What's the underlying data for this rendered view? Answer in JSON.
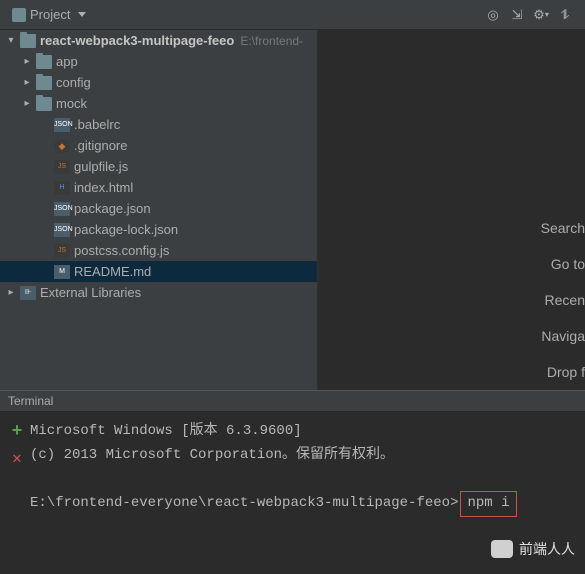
{
  "toolbar": {
    "project_label": "Project"
  },
  "tree": {
    "root": {
      "name": "react-webpack3-multipage-feeo",
      "path": "E:\\frontend-"
    },
    "folders": [
      {
        "name": "app"
      },
      {
        "name": "config"
      },
      {
        "name": "mock"
      }
    ],
    "files": [
      {
        "name": ".babelrc",
        "type": "json"
      },
      {
        "name": ".gitignore",
        "type": "git"
      },
      {
        "name": "gulpfile.js",
        "type": "js"
      },
      {
        "name": "index.html",
        "type": "html"
      },
      {
        "name": "package.json",
        "type": "json"
      },
      {
        "name": "package-lock.json",
        "type": "json"
      },
      {
        "name": "postcss.config.js",
        "type": "js"
      },
      {
        "name": "README.md",
        "type": "md"
      }
    ],
    "external_libs": "External Libraries"
  },
  "editor_tips": [
    "Search",
    "Go to",
    "Recen",
    "Naviga",
    "Drop f"
  ],
  "terminal": {
    "title": "Terminal",
    "line1": "Microsoft Windows [版本 6.3.9600]",
    "line2": "(c) 2013 Microsoft Corporation。保留所有权利。",
    "prompt": "E:\\frontend-everyone\\react-webpack3-multipage-feeo>",
    "command": "npm i"
  },
  "watermark": "前端人人"
}
